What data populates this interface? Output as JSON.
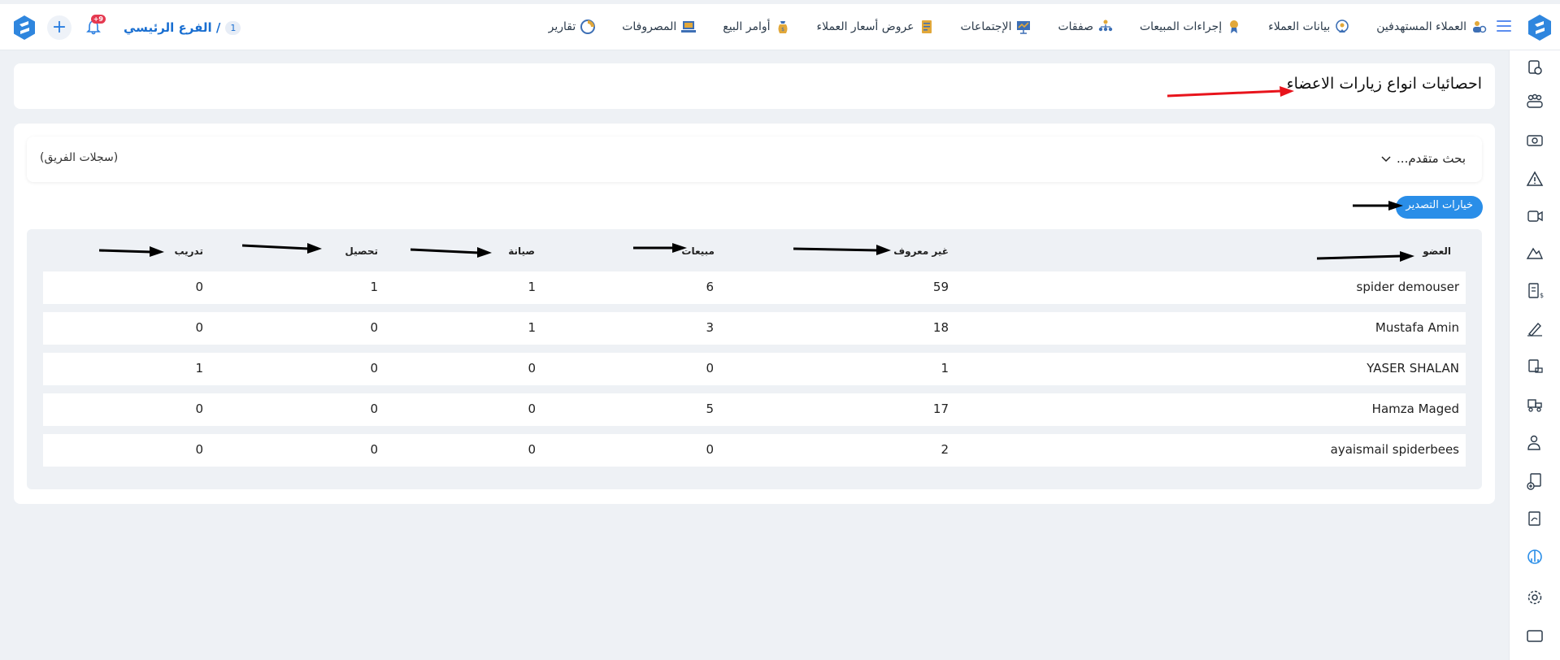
{
  "header": {
    "branch_num": "1",
    "branch_name": "الفرع الرئيسي /",
    "notification_count": "+9",
    "nav": [
      {
        "label": "العملاء المستهدفين",
        "icon": "targeted-clients-icon"
      },
      {
        "label": "بيانات العملاء",
        "icon": "client-data-icon"
      },
      {
        "label": "إجراءات المبيعات",
        "icon": "sales-procedures-icon"
      },
      {
        "label": "صفقات",
        "icon": "deals-icon"
      },
      {
        "label": "الإجتماعات",
        "icon": "meetings-icon"
      },
      {
        "label": "عروض أسعار العملاء",
        "icon": "quotes-icon"
      },
      {
        "label": "أوامر البيع",
        "icon": "sales-orders-icon"
      },
      {
        "label": "المصروفات",
        "icon": "expenses-icon"
      },
      {
        "label": "تقارير",
        "icon": "reports-icon"
      }
    ]
  },
  "page": {
    "title": "احصائيات انواع زيارات الاعضاء"
  },
  "search": {
    "toggle_label": "بحث متقدم...",
    "team_records": "(سجلات الفريق)"
  },
  "export_label": "خيارات التصدير",
  "table": {
    "headers": {
      "member": "العضو",
      "unknown": "غير معروف",
      "sales": "مبيعات",
      "maintenance": "صيانة",
      "collection": "تحصيل",
      "training": "تدريب"
    },
    "rows": [
      {
        "member": "spider demouser",
        "unknown": "59",
        "sales": "6",
        "maintenance": "1",
        "collection": "1",
        "training": "0"
      },
      {
        "member": "Mustafa Amin",
        "unknown": "18",
        "sales": "3",
        "maintenance": "1",
        "collection": "0",
        "training": "0"
      },
      {
        "member": "YASER SHALAN",
        "unknown": "1",
        "sales": "0",
        "maintenance": "0",
        "collection": "0",
        "training": "1"
      },
      {
        "member": "Hamza Maged",
        "unknown": "17",
        "sales": "5",
        "maintenance": "0",
        "collection": "0",
        "training": "0"
      },
      {
        "member": "ayaismail spiderbees",
        "unknown": "2",
        "sales": "0",
        "maintenance": "0",
        "collection": "0",
        "training": "0"
      }
    ]
  },
  "colors": {
    "accent": "#2a8ee8",
    "brand": "#1a6fd1",
    "badge": "#e53950",
    "annotation_red": "#e8141c",
    "annotation_black": "#000000"
  }
}
